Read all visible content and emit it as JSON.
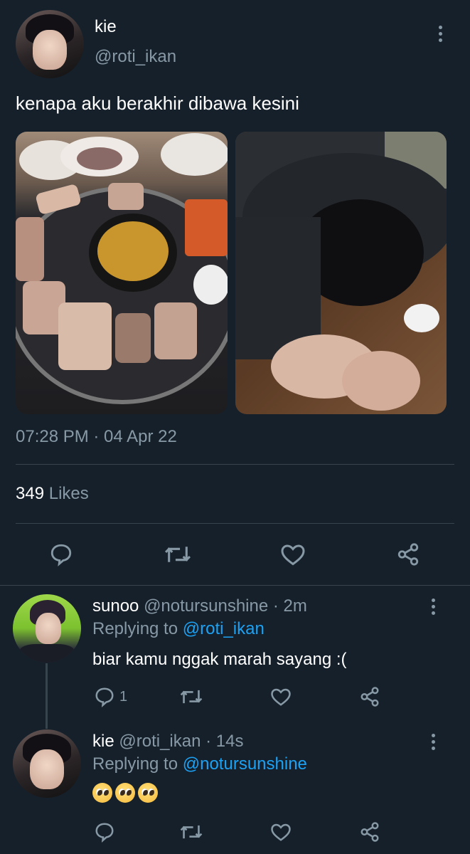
{
  "tweet": {
    "display_name": "kie",
    "handle": "@roti_ikan",
    "text": "kenapa aku berakhir dibawa kesini",
    "timestamp": "07:28 PM · 04 Apr 22",
    "likes_count": "349",
    "likes_label": "Likes",
    "images": [
      "korean-bbq-grill-photo",
      "person-sleeping-on-table-photo"
    ]
  },
  "replies": [
    {
      "display_name": "sunoo",
      "handle": "@notursunshine",
      "time": "· 2m",
      "replying_prefix": "Replying to",
      "replying_to": "@roti_ikan",
      "text": "biar kamu nggak marah sayang :(",
      "reply_count": "1"
    },
    {
      "display_name": "kie",
      "handle": "@roti_ikan",
      "time": "· 14s",
      "replying_prefix": "Replying to",
      "replying_to": "@notursunshine",
      "text": "🥺🥺🥺"
    }
  ],
  "icons": [
    "reply-icon",
    "retweet-icon",
    "like-icon",
    "share-icon",
    "more-icon"
  ],
  "colors": {
    "background": "#15202b",
    "muted": "#8899a6",
    "link": "#1da1f2",
    "divider": "#38444d"
  }
}
